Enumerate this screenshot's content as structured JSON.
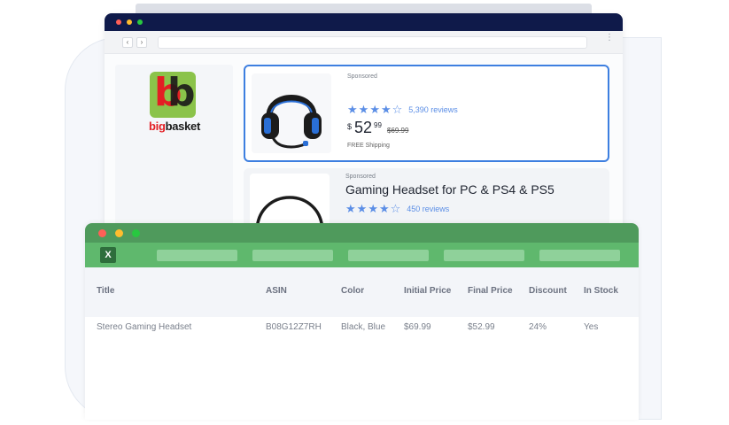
{
  "browser": {
    "nav_back": "‹",
    "nav_forward": "›",
    "menu": "⋮"
  },
  "logo": {
    "mark": "bb",
    "name_big": "big",
    "name_rest": "basket",
    "colors": {
      "green": "#8bc34a",
      "red": "#e31e24",
      "dark": "#1a1a1a"
    }
  },
  "products": [
    {
      "sponsored": "Sponsored",
      "rating": 4.5,
      "reviews": "5,390 reviews",
      "currency": "$",
      "price": "52",
      "price_cents": "99",
      "old_price": "$69.99",
      "shipping": "FREE Shipping",
      "image_icon": "headset-icon"
    },
    {
      "sponsored": "Sponsored",
      "title": "Gaming Headset for PC & PS4 & PS5",
      "rating": 4.5,
      "reviews": "450 reviews",
      "image_icon": "headset-outline-icon"
    }
  ],
  "sheet": {
    "icon_label": "X",
    "columns": [
      "Title",
      "ASIN",
      "Color",
      "Initial Price",
      "Final Price",
      "Discount",
      "In Stock"
    ],
    "rows": [
      [
        "Stereo Gaming Headset",
        "B08G12Z7RH",
        "Black, Blue",
        "$69.99",
        "$52.99",
        "24%",
        "Yes"
      ]
    ]
  },
  "colors": {
    "accent_blue": "#3d7fe0",
    "star_blue": "#5b8ee6",
    "browser_bar": "#0f1a4a",
    "sheet_green": "#5fb86d",
    "sheet_green_dark": "#4f9a5c"
  }
}
